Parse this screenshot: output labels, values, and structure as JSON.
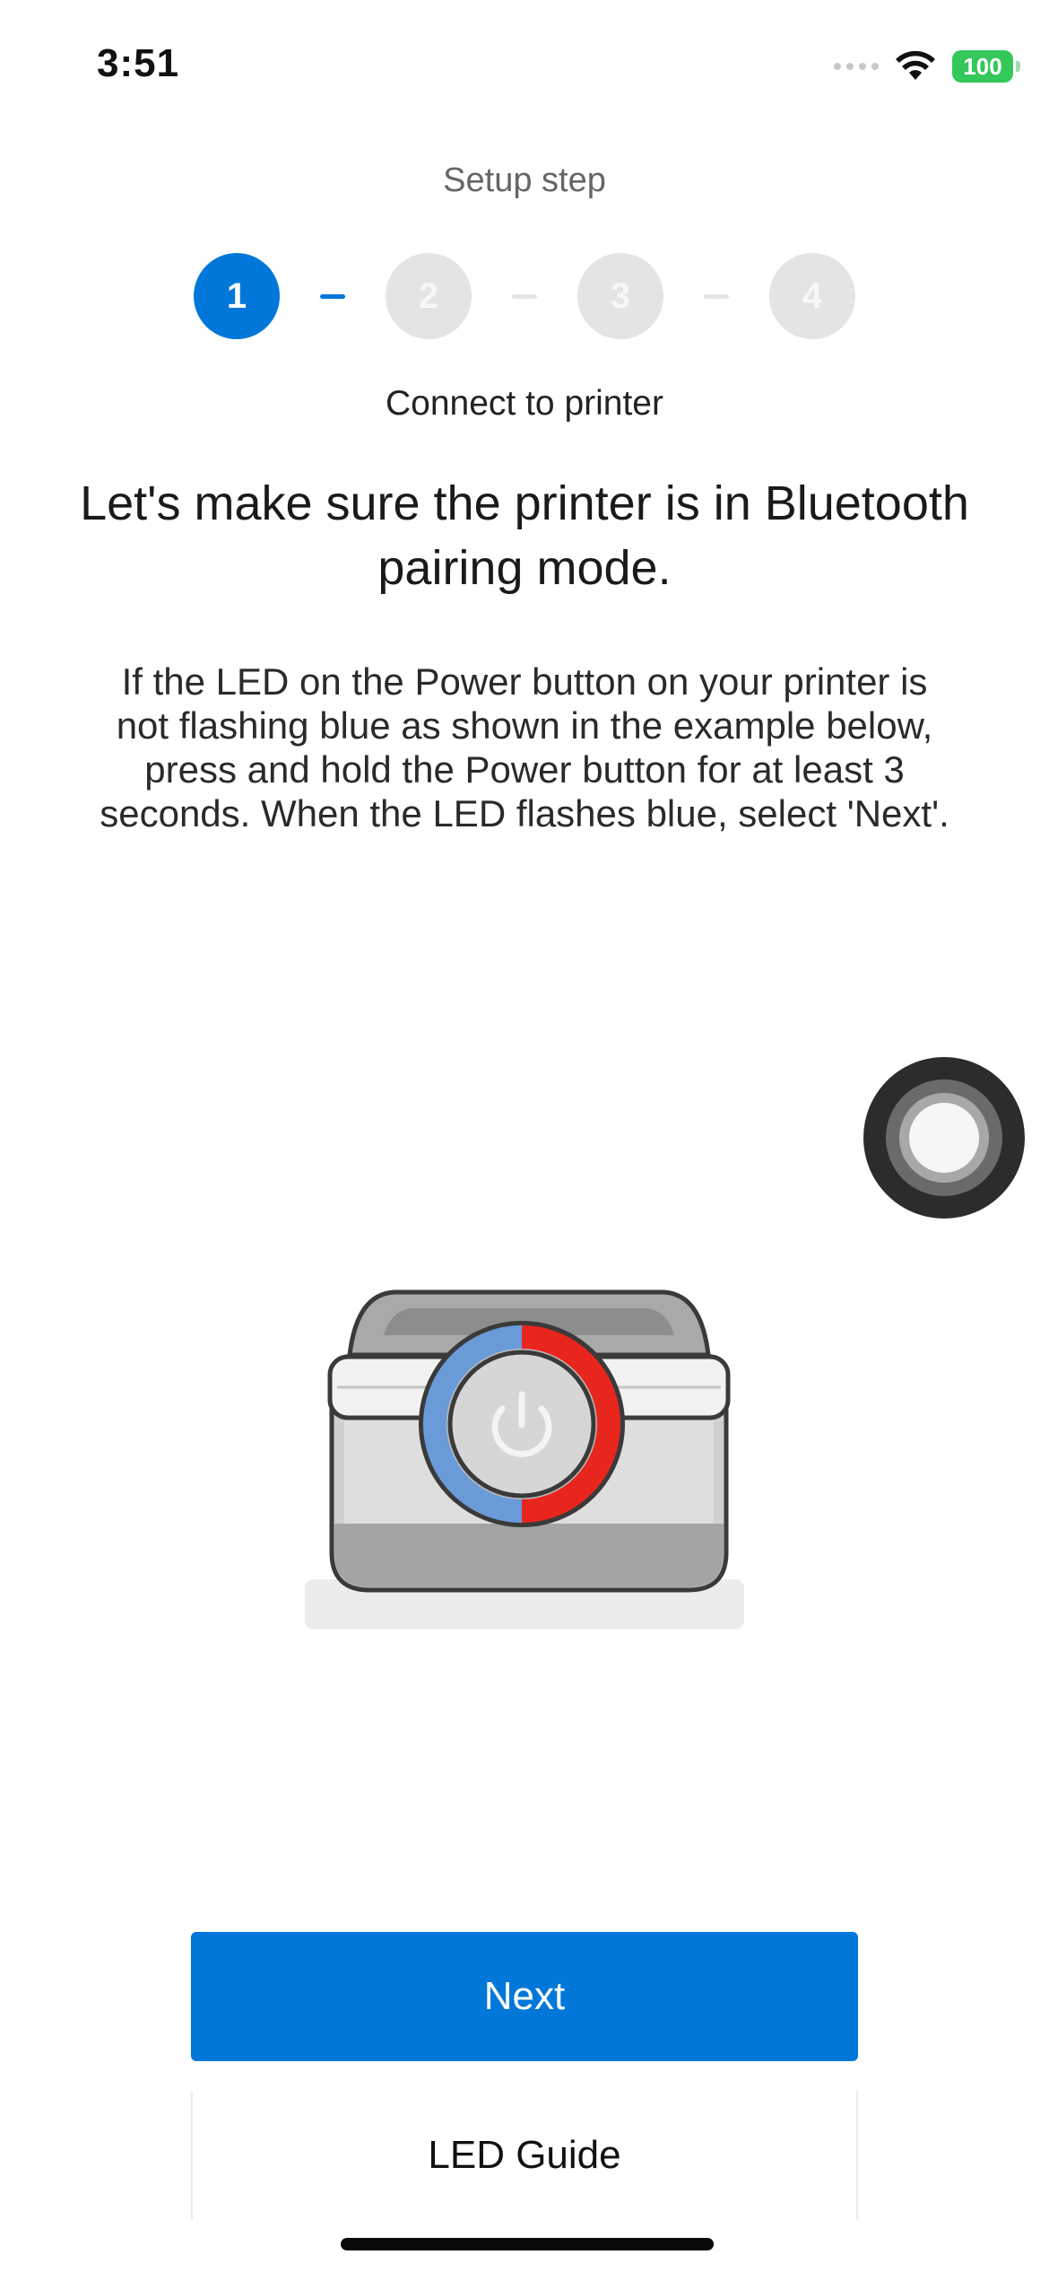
{
  "status_bar": {
    "time": "3:51",
    "battery_level": "100",
    "battery_color": "#34c759"
  },
  "setup": {
    "label": "Setup step",
    "steps": [
      "1",
      "2",
      "3",
      "4"
    ],
    "current_step": 1,
    "step_title": "Connect to printer"
  },
  "content": {
    "headline_line1": "Let's make sure the printer is in Bluetooth",
    "headline_line2": "pairing mode.",
    "body_lines": [
      "If the LED on the Power button on your printer is",
      "not flashing blue as shown in the example below,",
      "press and hold the Power button for at least 3",
      "seconds. When the LED flashes blue, select 'Next'."
    ]
  },
  "actions": {
    "next_label": "Next",
    "led_guide_label": "LED Guide"
  },
  "colors": {
    "accent": "#0077d9",
    "led_blue": "#6a9bd8",
    "led_red": "#e8261e"
  }
}
